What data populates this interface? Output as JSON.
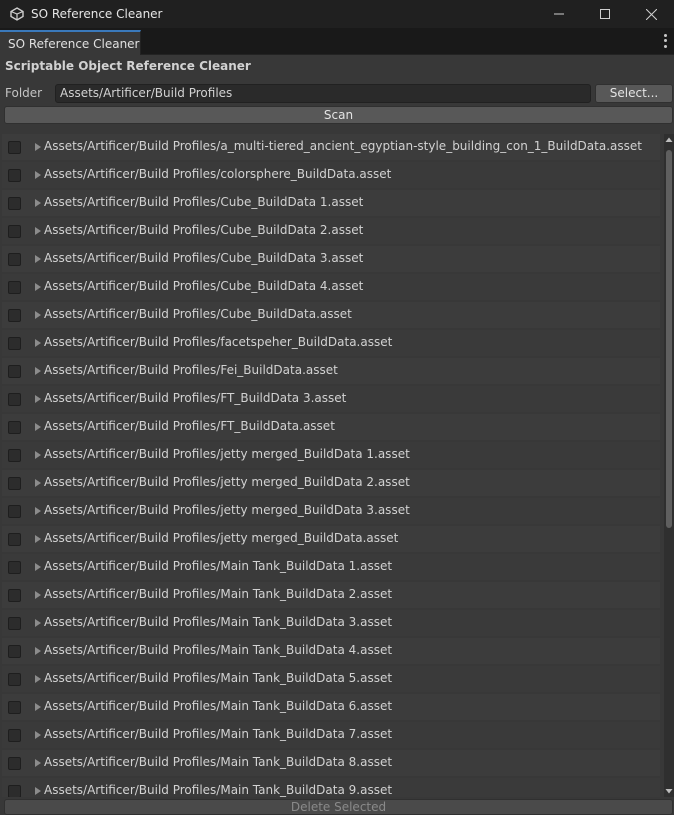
{
  "window": {
    "title": "SO Reference Cleaner",
    "icon": "unity-logo-icon"
  },
  "tab": {
    "label": "SO Reference Cleaner"
  },
  "header": {
    "title": "Scriptable Object Reference Cleaner"
  },
  "folder": {
    "label": "Folder",
    "value": "Assets/Artificer/Build Profiles",
    "select_label": "Select..."
  },
  "scan_label": "Scan",
  "delete_label": "Delete Selected",
  "items": [
    {
      "path": "Assets/Artificer/Build Profiles/a_multi-tiered_ancient_egyptian-style_building_con_1_BuildData.asset",
      "checked": false
    },
    {
      "path": "Assets/Artificer/Build Profiles/colorsphere_BuildData.asset",
      "checked": false
    },
    {
      "path": "Assets/Artificer/Build Profiles/Cube_BuildData 1.asset",
      "checked": false
    },
    {
      "path": "Assets/Artificer/Build Profiles/Cube_BuildData 2.asset",
      "checked": false
    },
    {
      "path": "Assets/Artificer/Build Profiles/Cube_BuildData 3.asset",
      "checked": false
    },
    {
      "path": "Assets/Artificer/Build Profiles/Cube_BuildData 4.asset",
      "checked": false
    },
    {
      "path": "Assets/Artificer/Build Profiles/Cube_BuildData.asset",
      "checked": false
    },
    {
      "path": "Assets/Artificer/Build Profiles/facetspeher_BuildData.asset",
      "checked": false
    },
    {
      "path": "Assets/Artificer/Build Profiles/Fei_BuildData.asset",
      "checked": false
    },
    {
      "path": "Assets/Artificer/Build Profiles/FT_BuildData 3.asset",
      "checked": false
    },
    {
      "path": "Assets/Artificer/Build Profiles/FT_BuildData.asset",
      "checked": false
    },
    {
      "path": "Assets/Artificer/Build Profiles/jetty merged_BuildData 1.asset",
      "checked": false
    },
    {
      "path": "Assets/Artificer/Build Profiles/jetty merged_BuildData 2.asset",
      "checked": false
    },
    {
      "path": "Assets/Artificer/Build Profiles/jetty merged_BuildData 3.asset",
      "checked": false
    },
    {
      "path": "Assets/Artificer/Build Profiles/jetty merged_BuildData.asset",
      "checked": false
    },
    {
      "path": "Assets/Artificer/Build Profiles/Main Tank_BuildData 1.asset",
      "checked": false
    },
    {
      "path": "Assets/Artificer/Build Profiles/Main Tank_BuildData 2.asset",
      "checked": false
    },
    {
      "path": "Assets/Artificer/Build Profiles/Main Tank_BuildData 3.asset",
      "checked": false
    },
    {
      "path": "Assets/Artificer/Build Profiles/Main Tank_BuildData 4.asset",
      "checked": false
    },
    {
      "path": "Assets/Artificer/Build Profiles/Main Tank_BuildData 5.asset",
      "checked": false
    },
    {
      "path": "Assets/Artificer/Build Profiles/Main Tank_BuildData 6.asset",
      "checked": false
    },
    {
      "path": "Assets/Artificer/Build Profiles/Main Tank_BuildData 7.asset",
      "checked": false
    },
    {
      "path": "Assets/Artificer/Build Profiles/Main Tank_BuildData 8.asset",
      "checked": false
    },
    {
      "path": "Assets/Artificer/Build Profiles/Main Tank_BuildData 9.asset",
      "checked": false
    }
  ],
  "colors": {
    "accent": "#3a79bb",
    "background": "#383838",
    "titlebar": "#202020"
  }
}
